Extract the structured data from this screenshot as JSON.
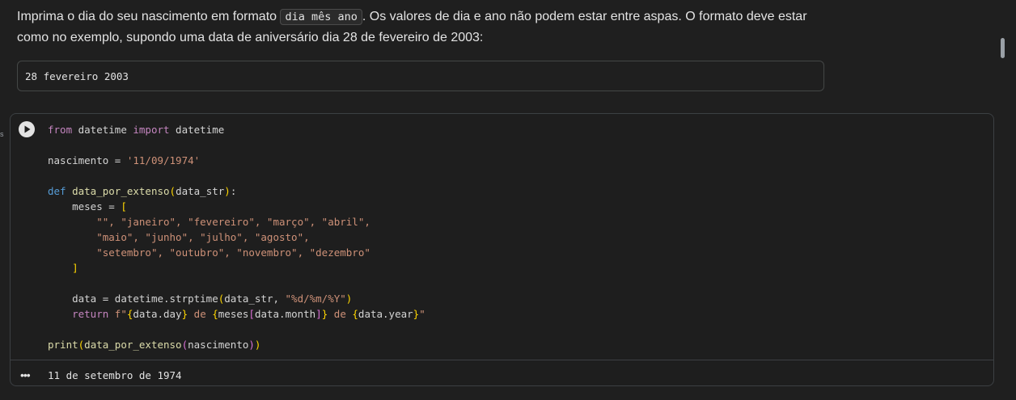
{
  "text_cell": {
    "part1": "Imprima o dia do seu nascimento em formato ",
    "inline_code": "dia mês ano",
    "part2": ". Os valores de dia e ano não podem estar entre aspas. O formato deve estar",
    "line2": "como no exemplo, supondo uma data de aniversário dia 28 de fevereiro de 2003:",
    "example_code": "28 fevereiro 2003"
  },
  "left_marker": "s",
  "code": {
    "t_from": "from",
    "t_mod": " datetime ",
    "t_import": "import",
    "t_cls": " datetime",
    "t_var_nasc": "nascimento",
    "t_eq": " = ",
    "t_date": "'11/09/1974'",
    "t_def": "def",
    "t_fname": "data_por_extenso",
    "t_param": "data_str",
    "t_meses": "meses",
    "m_row1": "\"\", \"janeiro\", \"fevereiro\", \"março\", \"abril\",",
    "m_row2": "\"maio\", \"junho\", \"julho\", \"agosto\",",
    "m_row3": "\"setembro\", \"outubro\", \"novembro\", \"dezembro\"",
    "t_data": "data",
    "t_strp": "datetime.strptime",
    "t_args": "data_str, ",
    "t_fmt": "\"%d/%m/%Y\"",
    "t_return": "return",
    "t_f": "f\"",
    "t_day": "data.day",
    "t_de1": " de ",
    "t_meses2": "meses",
    "t_month": "data.month",
    "t_year": "data.year",
    "t_endq": "\"",
    "t_print": "print",
    "t_arg2": "nascimento"
  },
  "output": {
    "text": "11 de setembro de 1974"
  }
}
